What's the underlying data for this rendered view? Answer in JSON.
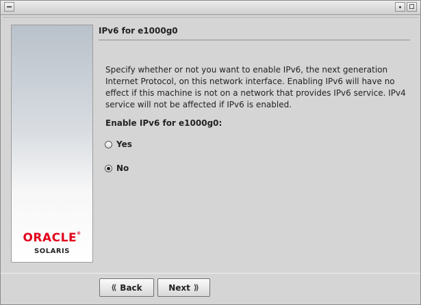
{
  "window": {
    "title": ""
  },
  "sidebar": {
    "brand": "ORACLE",
    "brand_mark": "®",
    "product": "SOLARIS"
  },
  "page": {
    "title": "IPv6 for e1000g0",
    "description": "Specify whether or not you want to enable IPv6, the next generation Internet Protocol, on this network interface.  Enabling IPv6 will have no effect if this machine is not on a network that provides IPv6 service.  IPv4 service will not be affected if IPv6 is enabled.",
    "question": "Enable IPv6 for e1000g0:",
    "options": [
      {
        "label": "Yes",
        "selected": false
      },
      {
        "label": "No",
        "selected": true
      }
    ]
  },
  "buttons": {
    "back_label": "Back",
    "next_label": "Next",
    "back_icon": "double-chevron-left-icon",
    "next_icon": "double-chevron-right-icon"
  },
  "colors": {
    "brand_red": "#e2001a",
    "window_bg": "#d5d5d5"
  }
}
